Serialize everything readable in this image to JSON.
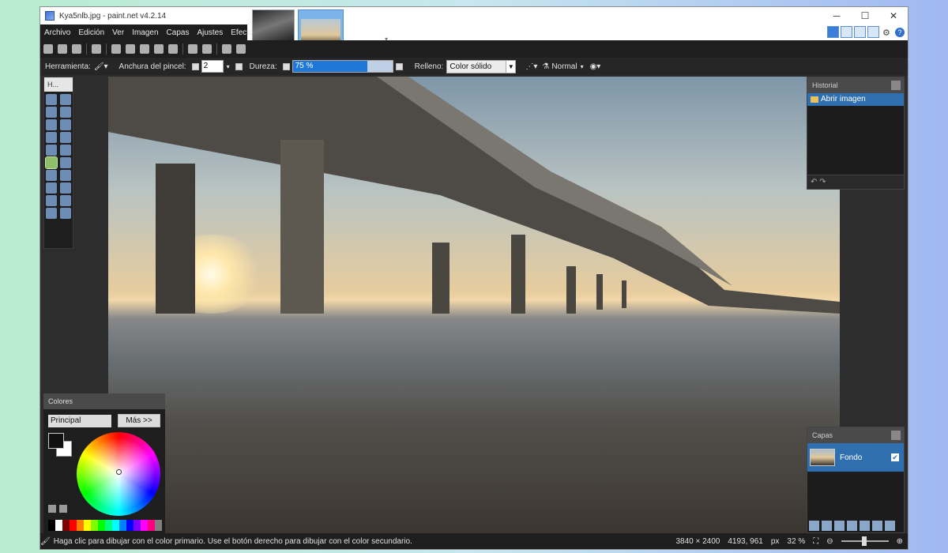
{
  "window": {
    "title": "Kya5nlb.jpg - paint.net v4.2.14",
    "min": "─",
    "max": "☐",
    "close": "✕"
  },
  "menu": [
    "Archivo",
    "Edición",
    "Ver",
    "Imagen",
    "Capas",
    "Ajustes",
    "Efectos"
  ],
  "options": {
    "tool_label": "Herramienta:",
    "brush_width_label": "Anchura del pincel:",
    "brush_width_value": "2",
    "hardness_label": "Dureza:",
    "hardness_value": "75 %",
    "hardness_fraction": 0.75,
    "fill_label": "Relleno:",
    "fill_value": "Color sólido",
    "blend_value": "Normal"
  },
  "tools_panel": {
    "header": "H..."
  },
  "colors_panel": {
    "header": "Colores",
    "mode": "Principal",
    "more_button": "Más >>",
    "primary_color": "#111111",
    "secondary_color": "#ffffff",
    "palette": [
      "#000000",
      "#ffffff",
      "#7f0000",
      "#ff0000",
      "#ff7f00",
      "#ffff00",
      "#7fff00",
      "#00ff00",
      "#00ff7f",
      "#00ffff",
      "#007fff",
      "#0000ff",
      "#7f00ff",
      "#ff00ff",
      "#ff007f",
      "#7f7f7f"
    ]
  },
  "history_panel": {
    "header": "Historial",
    "items": [
      "Abrir imagen"
    ]
  },
  "layers_panel": {
    "header": "Capas",
    "layers": [
      {
        "name": "Fondo",
        "visible": true
      }
    ]
  },
  "status": {
    "message": "Haga clic para dibujar con el color primario. Use el botón derecho para dibujar con el color secundario.",
    "size": "3840 × 2400",
    "cursor": "4193, 961",
    "units": "px",
    "zoom": "32 %"
  }
}
